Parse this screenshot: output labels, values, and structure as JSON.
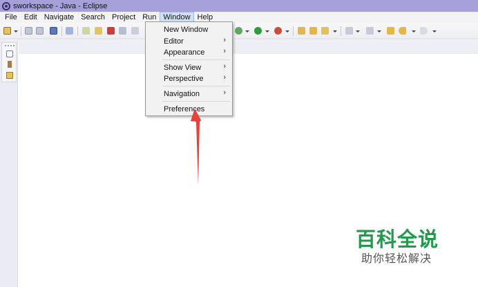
{
  "window": {
    "title": "sworkspace - Java - Eclipse"
  },
  "menubar": {
    "items": [
      {
        "label": "File"
      },
      {
        "label": "Edit"
      },
      {
        "label": "Navigate"
      },
      {
        "label": "Search"
      },
      {
        "label": "Project"
      },
      {
        "label": "Run"
      },
      {
        "label": "Window",
        "active": true
      },
      {
        "label": "Help"
      }
    ]
  },
  "window_menu": {
    "items": [
      {
        "label": "New Window",
        "submenu": false
      },
      {
        "label": "Editor",
        "submenu": true
      },
      {
        "label": "Appearance",
        "submenu": true
      },
      {
        "label": "Show View",
        "submenu": true
      },
      {
        "label": "Perspective",
        "submenu": true
      },
      {
        "label": "Navigation",
        "submenu": true
      },
      {
        "label": "Preferences",
        "submenu": false
      }
    ],
    "chevron": "›"
  },
  "toolbar": {
    "icons": [
      "new-wizard-icon",
      "save-icon",
      "save-all-icon",
      "terminal-icon",
      "pin-icon",
      "resume-icon",
      "suspend-icon",
      "terminate-icon",
      "disconnect-icon",
      "step-icon",
      "debug-icon",
      "run-icon",
      "external-tools-icon",
      "open-type-icon",
      "open-task-icon",
      "search-icon",
      "annotation-icon",
      "next-annotation-icon",
      "last-edit-icon",
      "back-icon",
      "forward-icon"
    ]
  },
  "watermark": {
    "title": "百科全说",
    "subtitle": "助你轻松解决"
  },
  "colors": {
    "titlebar": "#a59fda",
    "menu_active": "#cfe1f7",
    "arrow": "#e8403a",
    "watermark": "#1f9b4a"
  }
}
